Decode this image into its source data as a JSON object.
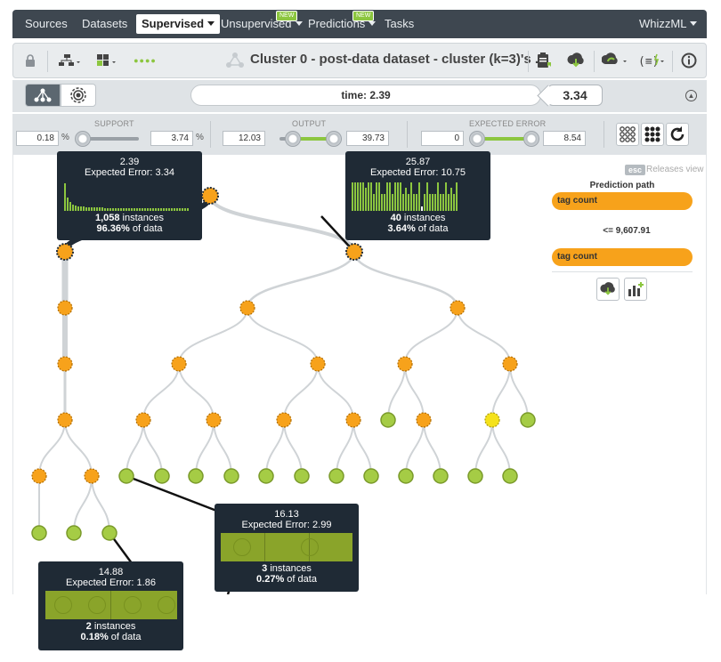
{
  "nav": {
    "items": [
      {
        "label": "Sources"
      },
      {
        "label": "Datasets"
      },
      {
        "label": "Supervised"
      },
      {
        "label": "Unsupervised"
      },
      {
        "label": "Predictions"
      },
      {
        "label": "Tasks"
      }
    ],
    "new_badge": "NEW",
    "user": "WhizzML"
  },
  "toolbar": {
    "title": "Cluster 0 - post-data dataset - cluster (k=3)'s ...",
    "dots": "●●●●"
  },
  "modebar": {
    "time_label": "time: 2.39",
    "prediction": "3.34"
  },
  "filters": {
    "support": {
      "label": "SUPPORT",
      "min": "0.18",
      "max": "3.74",
      "unit": "%"
    },
    "output": {
      "label": "OUTPUT",
      "min": "12.03",
      "max": "39.73"
    },
    "error": {
      "label": "EXPECTED ERROR",
      "min": "0",
      "max": "8.54"
    }
  },
  "tooltips": [
    {
      "value": "2.39",
      "error": "Expected Error: 3.34",
      "instances": "1,058",
      "instances_label": " instances",
      "pct": "96.36%",
      "pct_label": " of data",
      "hist": [
        0.9,
        0.45,
        0.3,
        0.22,
        0.18,
        0.16,
        0.15,
        0.14,
        0.13,
        0.13,
        0.12,
        0.12,
        0.11,
        0.11,
        0.11,
        0.1,
        0.1,
        0.1,
        0.1,
        0.1,
        0.1,
        0.1,
        0.1,
        0.1,
        0.1,
        0.1,
        0.1,
        0.1,
        0.1,
        0.1,
        0.1,
        0.1,
        0.1,
        0.1,
        0.1,
        0.1,
        0.1,
        0.1,
        0.1,
        0.1,
        0.1,
        0.1,
        0.1,
        0.1,
        0.1,
        0.1,
        0.1
      ]
    },
    {
      "value": "25.87",
      "error": "Expected Error: 10.75",
      "instances": "40",
      "instances_label": " instances",
      "pct": "3.64%",
      "pct_label": " of data",
      "hist": [
        0.95,
        0.95,
        0.95,
        0.95,
        0.95,
        0.75,
        0.95,
        0.95,
        0.55,
        0.95,
        0.95,
        0.55,
        0.55,
        0.95,
        0.95,
        0.55,
        0.95,
        0.95,
        0.95,
        0.55,
        0.75,
        0.55,
        0.95,
        0.55,
        0.55,
        0.95,
        0.15,
        0.55,
        0.95,
        0.55,
        0.55,
        0.55,
        0.95,
        0.55,
        0.55,
        0.95,
        0.55,
        0.75,
        0.55,
        0.95
      ]
    },
    {
      "value": "16.13",
      "error": "Expected Error: 2.99",
      "instances": "3",
      "instances_label": " instances",
      "pct": "0.27%",
      "pct_label": " of data"
    },
    {
      "value": "14.88",
      "error": "Expected Error: 1.86",
      "instances": "2",
      "instances_label": " instances",
      "pct": "0.18%",
      "pct_label": " of data"
    }
  ],
  "panel": {
    "esc": "esc",
    "release": "Releases view",
    "title": "Prediction path",
    "field1": "tag count",
    "condition": "<= 9,607.91",
    "field2": "tag count"
  },
  "colors": {
    "leaf": "#a5cc45",
    "internal": "#f7a21b",
    "highlight": "#f5e21b",
    "nav": "#3e4750",
    "tooltip": "#1f2a35"
  }
}
